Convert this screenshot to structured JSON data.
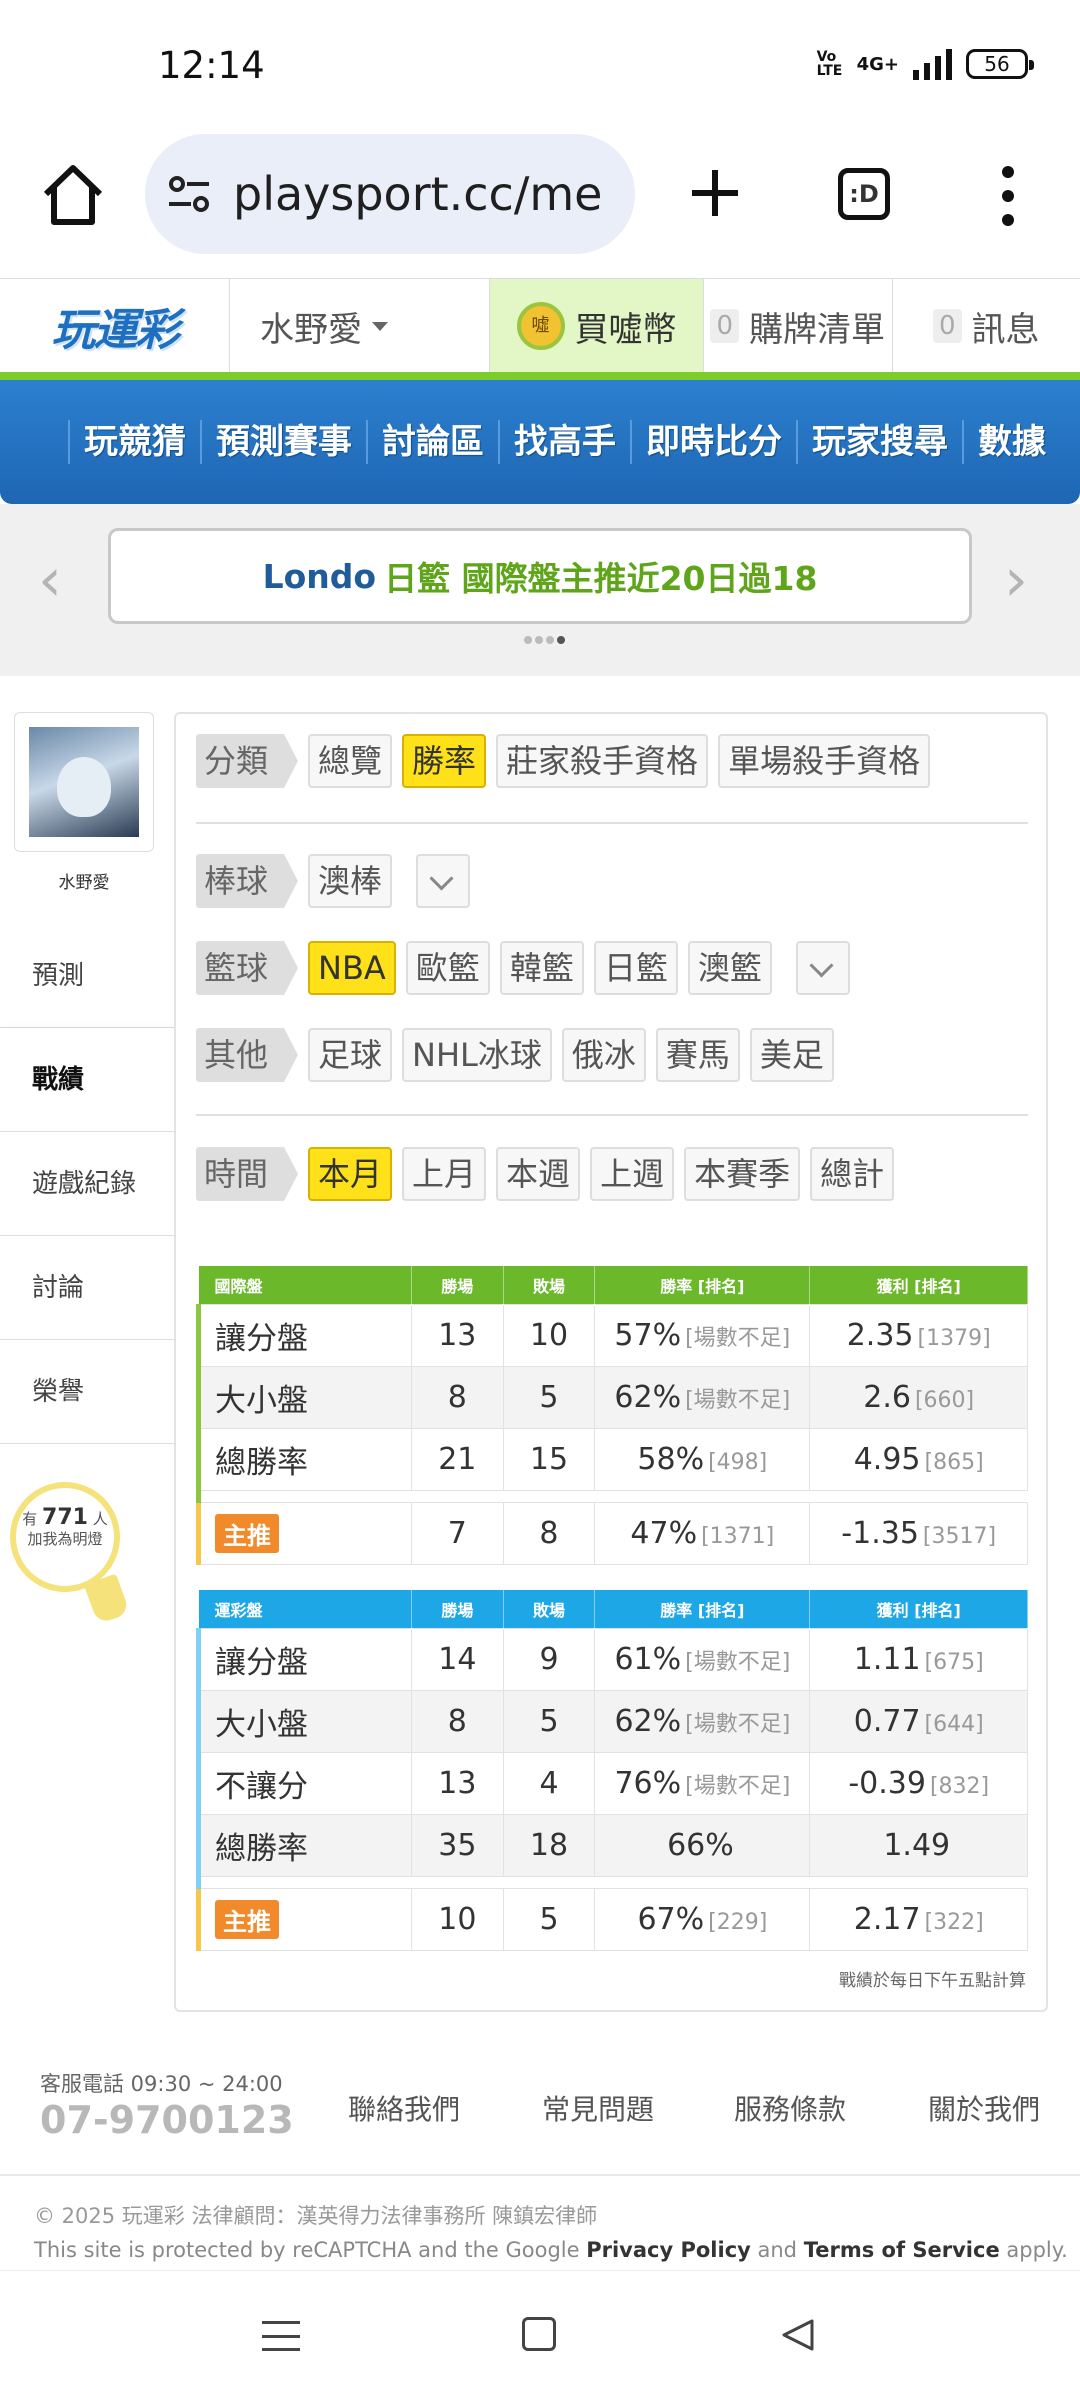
{
  "status": {
    "time": "12:14",
    "volte": "Vo LTE",
    "network": "4G+",
    "battery": "56"
  },
  "browser": {
    "url": "playsport.cc/men",
    "tab_label": ":D"
  },
  "site": {
    "logo": "玩運彩",
    "user_name": "水野愛",
    "coin_label": "買噓幣",
    "coin_icon_text": "噓",
    "list_count": "0",
    "list_label": "購牌清單",
    "msg_count": "0",
    "msg_label": "訊息"
  },
  "nav": [
    "玩競猜",
    "預測賽事",
    "討論區",
    "找高手",
    "即時比分",
    "玩家搜尋",
    "數據"
  ],
  "banner": {
    "part1": "Londo",
    "part2": "日籃 國際盤主推近20日過18"
  },
  "left": {
    "user_name": "水野愛",
    "items": [
      "預測",
      "戰績",
      "遊戲紀錄",
      "討論",
      "榮譽"
    ],
    "bulb_prefix": "有",
    "bulb_count": "771",
    "bulb_suffix": "人",
    "bulb_line2": "加我為明燈"
  },
  "filters": {
    "category_tag": "分類",
    "category_options": [
      "總覽",
      "勝率",
      "莊家殺手資格",
      "單場殺手資格"
    ],
    "baseball_tag": "棒球",
    "baseball_options": [
      "澳棒"
    ],
    "basketball_tag": "籃球",
    "basketball_options": [
      "NBA",
      "歐籃",
      "韓籃",
      "日籃",
      "澳籃"
    ],
    "other_tag": "其他",
    "other_options": [
      "足球",
      "NHL冰球",
      "俄冰",
      "賽馬",
      "美足"
    ],
    "time_tag": "時間",
    "time_options": [
      "本月",
      "上月",
      "本週",
      "上週",
      "本賽季",
      "總計"
    ]
  },
  "intl_table": {
    "headers": [
      "國際盤",
      "勝場",
      "敗場",
      "勝率 [排名]",
      "獲利 [排名]"
    ],
    "rows": [
      {
        "label": "讓分盤",
        "win": "13",
        "lose": "10",
        "rate": "57%",
        "rate_rank": "[場數不足]",
        "profit": "2.35",
        "profit_rank": "[1379]"
      },
      {
        "label": "大小盤",
        "win": "8",
        "lose": "5",
        "rate": "62%",
        "rate_rank": "[場數不足]",
        "profit": "2.6",
        "profit_rank": "[660]"
      },
      {
        "label": "總勝率",
        "win": "21",
        "lose": "15",
        "rate": "58%",
        "rate_rank": "[498]",
        "profit": "4.95",
        "profit_rank": "[865]"
      }
    ],
    "main": {
      "label": "主推",
      "win": "7",
      "lose": "8",
      "rate": "47%",
      "rate_rank": "[1371]",
      "profit": "-1.35",
      "profit_rank": "[3517]"
    }
  },
  "lottery_table": {
    "headers": [
      "運彩盤",
      "勝場",
      "敗場",
      "勝率 [排名]",
      "獲利 [排名]"
    ],
    "rows": [
      {
        "label": "讓分盤",
        "win": "14",
        "lose": "9",
        "rate": "61%",
        "rate_rank": "[場數不足]",
        "profit": "1.11",
        "profit_rank": "[675]"
      },
      {
        "label": "大小盤",
        "win": "8",
        "lose": "5",
        "rate": "62%",
        "rate_rank": "[場數不足]",
        "profit": "0.77",
        "profit_rank": "[644]"
      },
      {
        "label": "不讓分",
        "win": "13",
        "lose": "4",
        "rate": "76%",
        "rate_rank": "[場數不足]",
        "profit": "-0.39",
        "profit_rank": "[832]"
      },
      {
        "label": "總勝率",
        "win": "35",
        "lose": "18",
        "rate": "66%",
        "rate_rank": "",
        "profit": "1.49",
        "profit_rank": ""
      }
    ],
    "main": {
      "label": "主推",
      "win": "10",
      "lose": "5",
      "rate": "67%",
      "rate_rank": "[229]",
      "profit": "2.17",
      "profit_rank": "[322]"
    }
  },
  "note": "戰績於每日下午五點計算",
  "footer": {
    "service": "客服電話 09:30 ~ 24:00",
    "phone": "07-9700123",
    "links": [
      "聯絡我們",
      "常見問題",
      "服務條款",
      "關於我們"
    ],
    "copyright": "© 2025 玩運彩 法律顧問：漢英得力法律事務所 陳鎮宏律師",
    "recaptcha_pre": "This site is protected by reCAPTCHA and the Google ",
    "privacy": "Privacy Policy",
    "and": " and ",
    "terms": "Terms of Service",
    "apply": " apply."
  }
}
